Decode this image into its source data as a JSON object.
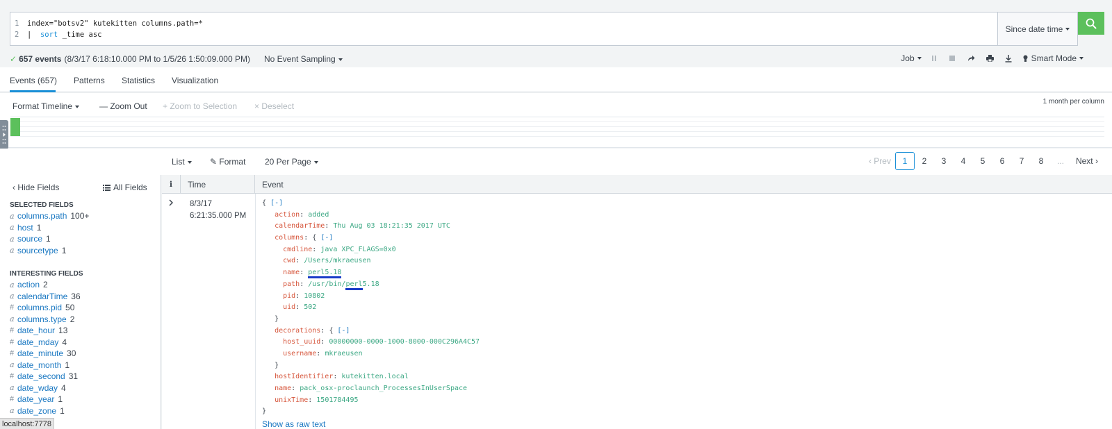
{
  "search": {
    "line1_num": "1",
    "line2_num": "2",
    "line1": "index=\"botsv2\" kutekitten columns.path=*",
    "line2_pipe": "|  ",
    "line2_kw": "sort",
    "line2_rest": " _time asc",
    "time_picker": "Since date time",
    "search_icon": "search-icon"
  },
  "status": {
    "check": "✓",
    "count": "657 events",
    "range": "(8/3/17 6:18:10.000 PM to 1/5/26 1:50:09.000 PM)",
    "sampling": "No Event Sampling",
    "job": "Job",
    "mode": "Smart Mode"
  },
  "tabs": [
    {
      "label": "Events (657)"
    },
    {
      "label": "Patterns"
    },
    {
      "label": "Statistics"
    },
    {
      "label": "Visualization"
    }
  ],
  "timeline": {
    "format": "Format Timeline",
    "zoom_out": "Zoom Out",
    "zoom_sel": "Zoom to Selection",
    "deselect": "Deselect",
    "per_column": "1 month per column"
  },
  "list_toolbar": {
    "list": "List",
    "format": "Format",
    "per_page": "20 Per Page"
  },
  "pager": {
    "prev": "Prev",
    "pages": [
      "1",
      "2",
      "3",
      "4",
      "5",
      "6",
      "7",
      "8"
    ],
    "ellipsis": "...",
    "next": "Next",
    "current": "1"
  },
  "fields": {
    "hide": "Hide Fields",
    "all": "All Fields",
    "selected_title": "SELECTED FIELDS",
    "selected": [
      {
        "type": "a",
        "name": "columns.path",
        "count": "100+"
      },
      {
        "type": "a",
        "name": "host",
        "count": "1"
      },
      {
        "type": "a",
        "name": "source",
        "count": "1"
      },
      {
        "type": "a",
        "name": "sourcetype",
        "count": "1"
      }
    ],
    "interesting_title": "INTERESTING FIELDS",
    "interesting": [
      {
        "type": "a",
        "name": "action",
        "count": "2"
      },
      {
        "type": "a",
        "name": "calendarTime",
        "count": "36"
      },
      {
        "type": "#",
        "name": "columns.pid",
        "count": "50"
      },
      {
        "type": "a",
        "name": "columns.type",
        "count": "2"
      },
      {
        "type": "#",
        "name": "date_hour",
        "count": "13"
      },
      {
        "type": "#",
        "name": "date_mday",
        "count": "4"
      },
      {
        "type": "#",
        "name": "date_minute",
        "count": "30"
      },
      {
        "type": "a",
        "name": "date_month",
        "count": "1"
      },
      {
        "type": "#",
        "name": "date_second",
        "count": "31"
      },
      {
        "type": "a",
        "name": "date_wday",
        "count": "4"
      },
      {
        "type": "#",
        "name": "date_year",
        "count": "1"
      },
      {
        "type": "a",
        "name": "date_zone",
        "count": "1"
      }
    ]
  },
  "results": {
    "col_i": "i",
    "col_time": "Time",
    "col_event": "Event",
    "time_date": "8/3/17",
    "time_clock": "6:21:35.000 PM",
    "raw_link": "Show as raw text",
    "json": {
      "open": "{ ",
      "toggle": "[-]",
      "action_k": "action",
      "action_v": "added",
      "calendarTime_k": "calendarTime",
      "calendarTime_v": "Thu Aug 03 18:21:35 2017 UTC",
      "columns_k": "columns",
      "cmdline_k": "cmdline",
      "cmdline_v": "java XPC_FLAGS=0x0",
      "cwd_k": "cwd",
      "cwd_v": "/Users/mkraeusen",
      "name_k": "name",
      "name_v": "perl5.18",
      "path_k": "path",
      "path_v_pre": "/usr/bin/",
      "path_v_hl": "perl",
      "path_v_post": "5.18",
      "pid_k": "pid",
      "pid_v": "10802",
      "uid_k": "uid",
      "uid_v": "502",
      "decorations_k": "decorations",
      "host_uuid_k": "host_uuid",
      "host_uuid_v": "00000000-0000-1000-8000-000C296A4C57",
      "username_k": "username",
      "username_v": "mkraeusen",
      "hostIdentifier_k": "hostIdentifier",
      "hostIdentifier_v": "kutekitten.local",
      "name2_k": "name",
      "name2_v": "pack_osx-proclaunch_ProcessesInUserSpace",
      "unixTime_k": "unixTime",
      "unixTime_v": "1501784495",
      "close": "}"
    }
  },
  "footer": {
    "localhost": "localhost:7778"
  },
  "colors": {
    "accent": "#1a8fd7",
    "success": "#5cc05c",
    "json_key": "#d6563c",
    "json_value": "#3ca884"
  }
}
